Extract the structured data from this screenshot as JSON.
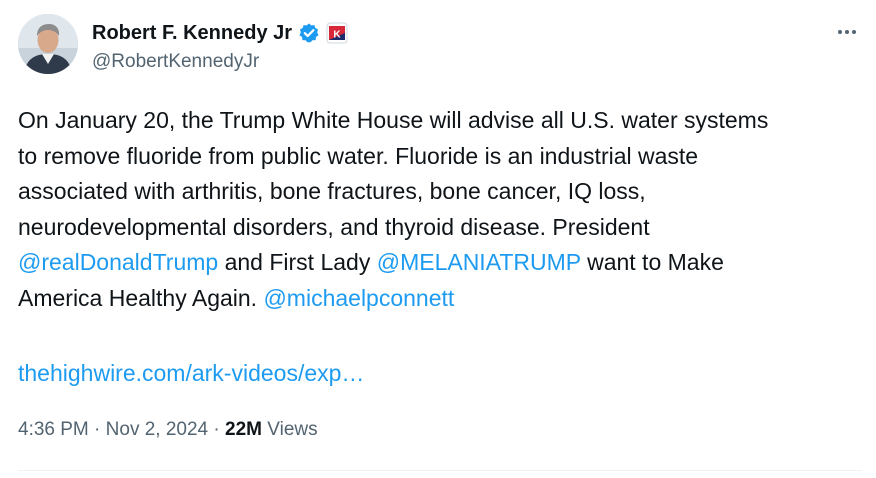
{
  "author": {
    "display_name": "Robert F. Kennedy Jr",
    "handle": "@RobertKennedyJr",
    "verified_icon": "verified-badge-icon",
    "affiliate_icon": "campaign-affiliate-icon",
    "affiliate_text": "K",
    "verified_color": "#1d9bf0",
    "affiliate_color": "#d62839"
  },
  "tweet": {
    "lines": [
      [
        {
          "text": "On January 20, the Trump White House will advise all U.S. water systems"
        }
      ],
      [
        {
          "text": "to remove fluoride from public water. Fluoride is an industrial waste"
        }
      ],
      [
        {
          "text": "associated with arthritis, bone fractures, bone cancer, IQ loss,"
        }
      ],
      [
        {
          "text": "neurodevelopmental disorders, and thyroid disease. President"
        }
      ],
      [
        {
          "text": "@realDonaldTrump",
          "type": "mention"
        },
        {
          "text": " and First Lady "
        },
        {
          "text": "@MELANIATRUMP",
          "type": "mention"
        },
        {
          "text": " want to Make"
        }
      ],
      [
        {
          "text": "America Healthy Again. "
        },
        {
          "text": "@michaelpconnett",
          "type": "mention"
        }
      ]
    ],
    "link": "thehighwire.com/ark-videos/exp…",
    "mention_color": "#1d9bf0"
  },
  "meta": {
    "time": "4:36 PM",
    "separator": " · ",
    "date": "Nov 2, 2024",
    "views_count": "22M",
    "views_label": " Views"
  },
  "more_icon": "more-options-icon"
}
